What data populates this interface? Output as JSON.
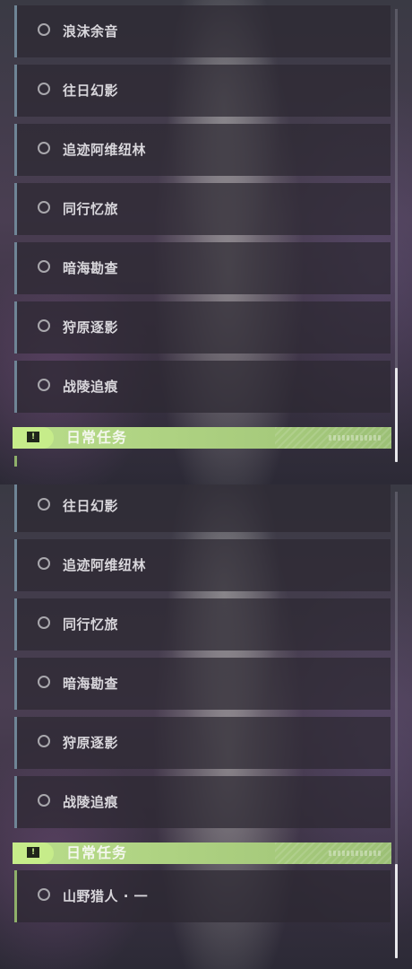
{
  "top": {
    "items": [
      {
        "label": "浪沫余音"
      },
      {
        "label": "往日幻影"
      },
      {
        "label": "追迹阿维纽林"
      },
      {
        "label": "同行忆旅"
      },
      {
        "label": "暗海勘查"
      },
      {
        "label": "狩原逐影"
      },
      {
        "label": "战陵追痕"
      }
    ],
    "category": {
      "title": "日常任务",
      "icon": "exclamation-icon"
    }
  },
  "bottom": {
    "items": [
      {
        "label": "往日幻影"
      },
      {
        "label": "追迹阿维纽林"
      },
      {
        "label": "同行忆旅"
      },
      {
        "label": "暗海勘查"
      },
      {
        "label": "狩原逐影"
      },
      {
        "label": "战陵追痕"
      }
    ],
    "category": {
      "title": "日常任务",
      "icon": "exclamation-icon"
    },
    "daily_items": [
      {
        "label": "山野猎人 · 一"
      }
    ]
  },
  "colors": {
    "category_accent": "#b9dd8a",
    "item_border": "#6f8596",
    "daily_border": "#8fb06a"
  }
}
